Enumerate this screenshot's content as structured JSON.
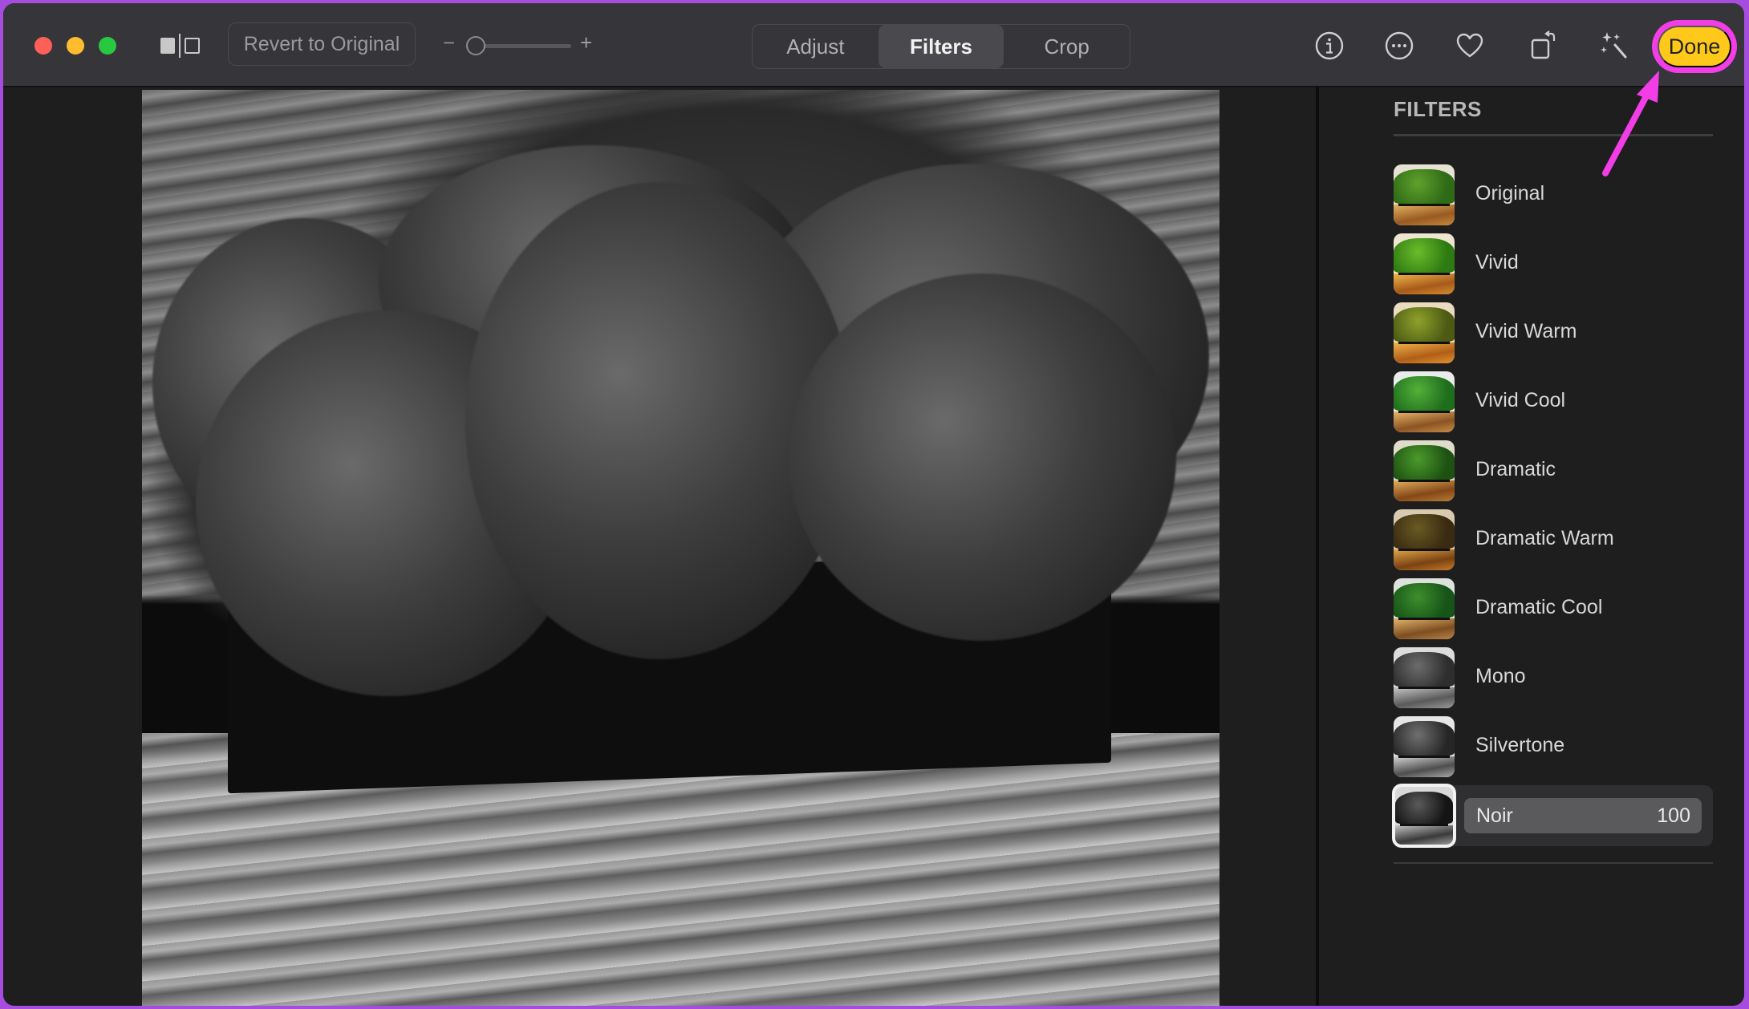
{
  "toolbar": {
    "revert_label": "Revert to Original",
    "zoom_minus": "−",
    "zoom_plus": "+",
    "zoom_level_fraction": 0.0,
    "segments": [
      {
        "label": "Adjust",
        "active": false
      },
      {
        "label": "Filters",
        "active": true
      },
      {
        "label": "Crop",
        "active": false
      }
    ],
    "icons": [
      "info-icon",
      "more-options-icon",
      "favorite-heart-icon",
      "rotate-icon",
      "auto-enhance-wand-icon"
    ],
    "done_label": "Done"
  },
  "panel": {
    "title": "FILTERS",
    "filters": [
      {
        "label": "Original",
        "palette": "color"
      },
      {
        "label": "Vivid",
        "palette": "vivid"
      },
      {
        "label": "Vivid Warm",
        "palette": "warm"
      },
      {
        "label": "Vivid Cool",
        "palette": "cool"
      },
      {
        "label": "Dramatic",
        "palette": "dramatic"
      },
      {
        "label": "Dramatic Warm",
        "palette": "dramatic-warm"
      },
      {
        "label": "Dramatic Cool",
        "palette": "dramatic-cool"
      },
      {
        "label": "Mono",
        "palette": "mono"
      },
      {
        "label": "Silvertone",
        "palette": "silver"
      },
      {
        "label": "Noir",
        "palette": "noir",
        "selected": true,
        "intensity": "100"
      }
    ]
  },
  "annotation": {
    "highlight_color": "#f33ee8",
    "target": "Done button"
  },
  "colors": {
    "done_bg": "#fec91b",
    "toolbar_bg": "#36363a",
    "panel_bg": "#1e1e1e"
  }
}
